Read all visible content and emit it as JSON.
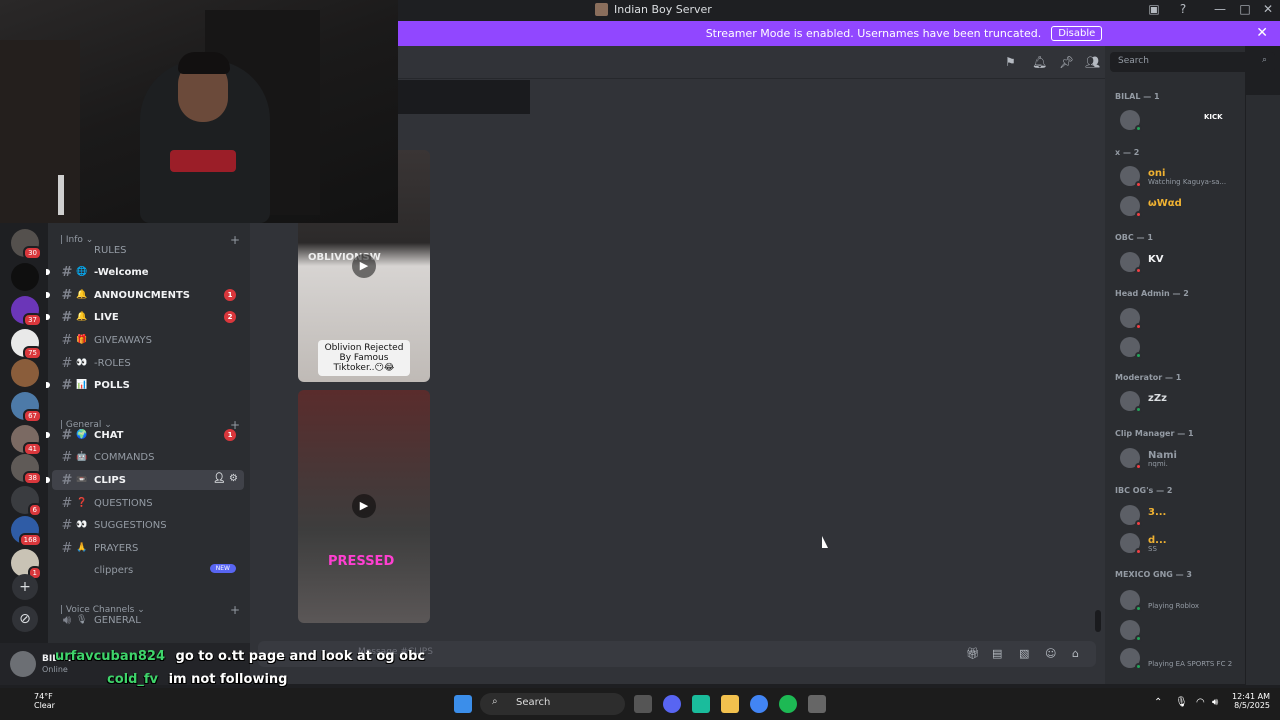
{
  "titlebar": {
    "title": "Indian Boy Server"
  },
  "banner": {
    "message": "Streamer Mode is enabled. Usernames have been truncated.",
    "disable_label": "Disable",
    "color": "#9147ff"
  },
  "servers": [
    {
      "badge": "30",
      "color": "#54504d"
    },
    {
      "badge": "",
      "color": "#0f0f0f"
    },
    {
      "badge": "37",
      "color": "#6b36b8"
    },
    {
      "badge": "75",
      "color": "#e9e9e9"
    },
    {
      "badge": "",
      "color": "#8a5d3b"
    },
    {
      "badge": "67",
      "color": "#4d7aa8"
    },
    {
      "badge": "41",
      "color": "#7b6a63"
    },
    {
      "badge": "38",
      "color": "#5f5a57"
    },
    {
      "badge": "6",
      "color": "#3a3c40"
    },
    {
      "badge": "168",
      "color": "#2f5ca6"
    },
    {
      "badge": "1",
      "color": "#c9c3b5"
    }
  ],
  "channels": {
    "cat_info": "| Info",
    "cat_general": "| General",
    "cat_voice": "| Voice Channels",
    "items": [
      {
        "label": "RULES",
        "emoji": "",
        "mention": ""
      },
      {
        "label": "-Welcome",
        "emoji": "🌐",
        "mention": ""
      },
      {
        "label": "ANNOUNCMENTS",
        "emoji": "🔔",
        "mention": "1"
      },
      {
        "label": "LIVE",
        "emoji": "🔔",
        "mention": "2"
      },
      {
        "label": "GIVEAWAYS",
        "emoji": "🎁",
        "mention": ""
      },
      {
        "label": "-ROLES",
        "emoji": "👀",
        "mention": ""
      },
      {
        "label": "POLLS",
        "emoji": "📊",
        "mention": ""
      },
      {
        "label": "CHAT",
        "emoji": "🌍",
        "mention": "1"
      },
      {
        "label": "COMMANDS",
        "emoji": "🤖",
        "mention": ""
      },
      {
        "label": "CLIPS",
        "emoji": "📼",
        "mention": ""
      },
      {
        "label": "QUESTIONS",
        "emoji": "❓",
        "mention": ""
      },
      {
        "label": "SUGGESTIONS",
        "emoji": "👀",
        "mention": ""
      },
      {
        "label": "PRAYERS",
        "emoji": "🙏",
        "mention": ""
      },
      {
        "label": "clippers",
        "emoji": "",
        "mention": "",
        "tag": "NEW"
      },
      {
        "label": "GENERAL",
        "emoji": "🎙",
        "mention": ""
      }
    ]
  },
  "user": {
    "name": "BILAL",
    "status": "Online"
  },
  "chat": {
    "clip1_caption": "Oblivion Rejected By Famous Tiktoker..😶😂",
    "clip1_tag": "OBLIVIONSW",
    "clip2_tag": "PRESSED",
    "composer_placeholder": "Message #CLIPS"
  },
  "overlay_chat": [
    {
      "user": "urfavcuban824",
      "message": "go to o.tt page and look at og obc",
      "color": "#3fd46b"
    },
    {
      "user": "cold_fv",
      "message": "im not following",
      "color": "#3fd46b"
    }
  ],
  "members": {
    "search_placeholder": "Search",
    "groups": [
      {
        "header": "BILAL — 1",
        "members": [
          {
            "name": "",
            "activity": "",
            "tag": "KICK",
            "color": "#7c3aed",
            "status": "#23a55a"
          }
        ]
      },
      {
        "header": "x — 2",
        "members": [
          {
            "name": "oni",
            "activity": "Watching Kaguya-sa...",
            "color": "#f0b232",
            "status": "#f23f43"
          },
          {
            "name": "ωWαd",
            "activity": "",
            "color": "#f0b232",
            "status": "#f23f43"
          }
        ]
      },
      {
        "header": "OBC — 1",
        "members": [
          {
            "name": "KV",
            "activity": "",
            "color": "#f2f3f5",
            "status": "#f23f43"
          }
        ]
      },
      {
        "header": "Head Admin — 2",
        "members": [
          {
            "name": "",
            "activity": "",
            "color": "#f23f43",
            "status": "#f23f43"
          },
          {
            "name": "",
            "activity": "",
            "color": "#dbdee1",
            "status": "#23a55a"
          }
        ]
      },
      {
        "header": "Moderator — 1",
        "members": [
          {
            "name": "zZz",
            "activity": "",
            "color": "#dbdee1",
            "status": "#23a55a"
          }
        ]
      },
      {
        "header": "Clip Manager — 1",
        "members": [
          {
            "name": "Nami",
            "activity": "nqmi.",
            "color": "#949ba4",
            "status": "#f23f43"
          }
        ]
      },
      {
        "header": "IBC OG's — 2",
        "members": [
          {
            "name": "3...",
            "activity": "",
            "color": "#f0b232",
            "status": "#f23f43"
          },
          {
            "name": "d...",
            "activity": "SS",
            "color": "#f0b232",
            "status": "#f23f43"
          }
        ]
      },
      {
        "header": "MEXICO GNG — 3",
        "members": [
          {
            "name": "",
            "activity": "Playing Roblox",
            "color": "#23a55a",
            "status": "#23a55a"
          },
          {
            "name": "",
            "activity": "",
            "color": "#23a55a",
            "status": "#23a55a"
          },
          {
            "name": "",
            "activity": "Playing EA SPORTS FC 2",
            "color": "#23a55a",
            "status": "#23a55a"
          }
        ]
      }
    ]
  },
  "taskbar": {
    "weather_temp": "74°F",
    "weather_desc": "Clear",
    "search_label": "Search",
    "time": "12:41 AM",
    "date": "8/5/2025"
  }
}
